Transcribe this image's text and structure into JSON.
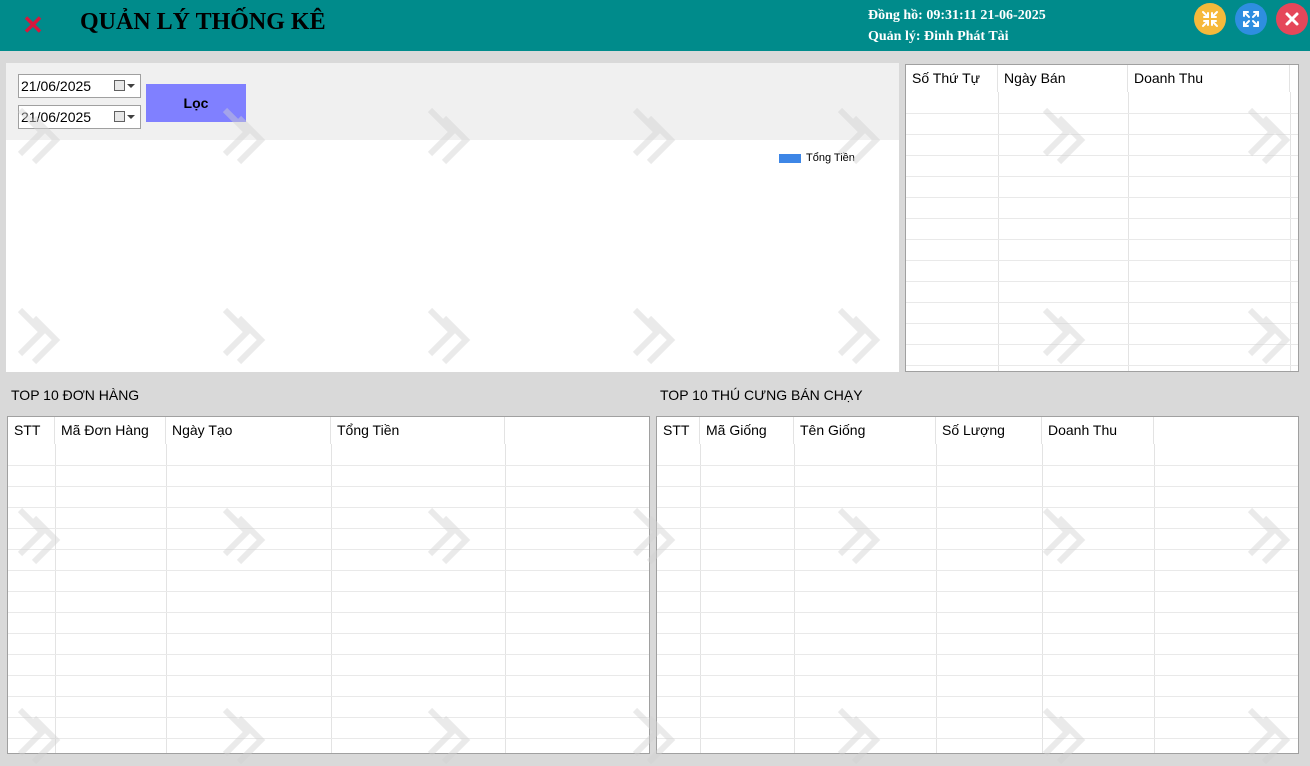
{
  "window": {
    "title": "QUẢN LÝ THỐNG KÊ",
    "clock_text": "Đồng hồ: 09:31:11 21-06-2025",
    "manager_text": "Quản lý: Đinh Phát Tài",
    "icons": {
      "close": "close-x-icon",
      "minimize": "minimize-icon",
      "maximize": "maximize-icon",
      "window_close": "window-close-icon"
    },
    "colors": {
      "titlebar": "#008b8b",
      "minimize": "#f6b93b",
      "maximize": "#2e8ee0",
      "close": "#e5475a",
      "close_x": "#d9163c",
      "filter_button": "#8080ff"
    }
  },
  "filter": {
    "from_date": "21/06/2025",
    "to_date": "21/06/2025",
    "button_label": "Lọc"
  },
  "chart": {
    "legend_label": "Tổng Tiền",
    "legend_color": "#3d86e6"
  },
  "sales_table": {
    "columns": [
      "Số Thứ Tự",
      "Ngày Bán",
      "Doanh Thu"
    ]
  },
  "orders_section": {
    "title": "TOP 10 ĐƠN HÀNG",
    "columns": [
      "STT",
      "Mã Đơn Hàng",
      "Ngày Tạo",
      "Tổng Tiền"
    ]
  },
  "pets_section": {
    "title": "TOP 10 THÚ CƯNG BÁN CHẠY",
    "columns": [
      "STT",
      "Mã Giống",
      "Tên Giống",
      "Số Lượng",
      "Doanh Thu"
    ]
  }
}
